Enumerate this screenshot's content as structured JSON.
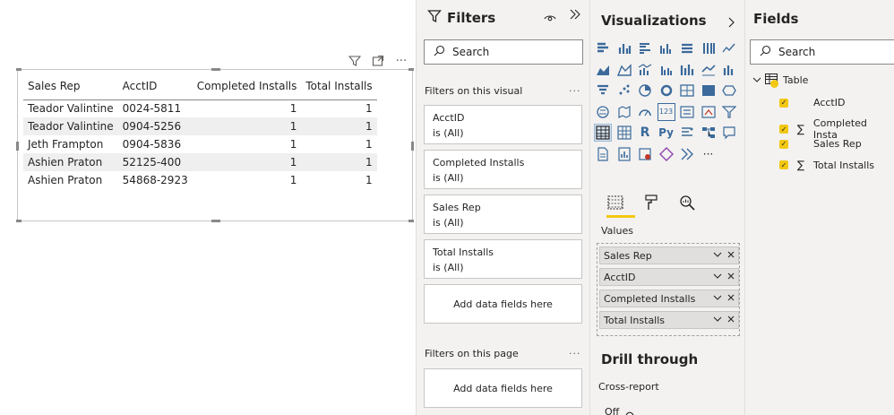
{
  "table": {
    "headers": [
      "Sales Rep",
      "AcctID",
      "Completed Installs",
      "Total Installs"
    ],
    "rows": [
      [
        "Teador Valintine",
        "0024-5811",
        "1",
        "1"
      ],
      [
        "Teador Valintine",
        "0904-5256",
        "1",
        "1"
      ],
      [
        "Jeth Frampton",
        "0904-5836",
        "1",
        "1"
      ],
      [
        "Ashien Praton",
        "52125-400",
        "1",
        "1"
      ],
      [
        "Ashien Praton",
        "54868-2923",
        "1",
        "1"
      ]
    ]
  },
  "filters": {
    "title": "Filters",
    "search_placeholder": "Search",
    "on_visual_label": "Filters on this visual",
    "cards": [
      {
        "field": "AcctID",
        "state": "is (All)"
      },
      {
        "field": "Completed Installs",
        "state": "is (All)"
      },
      {
        "field": "Sales Rep",
        "state": "is (All)"
      },
      {
        "field": "Total Installs",
        "state": "is (All)"
      }
    ],
    "add_fields_label": "Add data fields here",
    "on_page_label": "Filters on this page",
    "add_fields_page_label": "Add data fields here"
  },
  "visualizations": {
    "title": "Visualizations",
    "values_label": "Values",
    "value_fields": [
      "Sales Rep",
      "AcctID",
      "Completed Installs",
      "Total Installs"
    ],
    "drill_title": "Drill through",
    "cross_report_label": "Cross-report",
    "toggle_state": "Off",
    "more_label": "···",
    "r_label": "R",
    "py_label": "Py",
    "num_label": "123"
  },
  "fields": {
    "title": "Fields",
    "search_placeholder": "Search",
    "table_name": "Table",
    "items": [
      {
        "name": "AcctID",
        "sigma": false
      },
      {
        "name": "Completed Insta",
        "sigma": true
      },
      {
        "name": "Sales Rep",
        "sigma": false
      },
      {
        "name": "Total Installs",
        "sigma": true
      }
    ]
  },
  "colors": {
    "accent_yellow": "#f2c811",
    "pane_bg": "#f3f2f1",
    "row_alt": "#efefef",
    "icon_blue": "#3b6a9b"
  }
}
